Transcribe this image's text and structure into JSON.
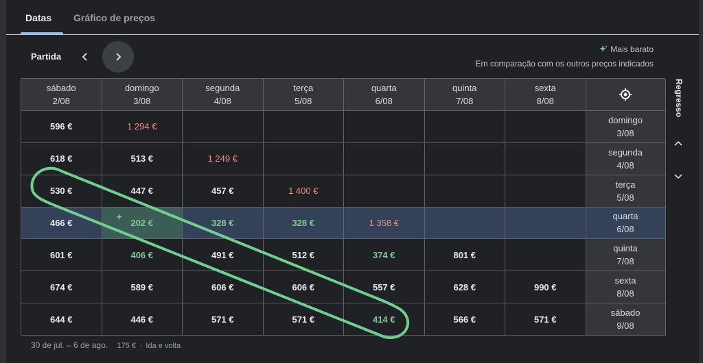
{
  "tabs": [
    {
      "label": "Datas",
      "active": true
    },
    {
      "label": "Gráfico de preços",
      "active": false
    }
  ],
  "toolbar": {
    "departure_label": "Partida",
    "cheapest_label": "Mais barato",
    "comparison_note": "Em comparação com os outros preços indicados"
  },
  "grid": {
    "columns": [
      {
        "day": "sábado",
        "date": "2/08"
      },
      {
        "day": "domingo",
        "date": "3/08"
      },
      {
        "day": "segunda",
        "date": "4/08"
      },
      {
        "day": "terça",
        "date": "5/08"
      },
      {
        "day": "quarta",
        "date": "6/08"
      },
      {
        "day": "quinta",
        "date": "7/08"
      },
      {
        "day": "sexta",
        "date": "8/08"
      }
    ],
    "rows": [
      {
        "day": "domingo",
        "date": "3/08",
        "cells": [
          {
            "v": "596 €"
          },
          {
            "v": "1 294 €",
            "s": "expensive"
          },
          {
            "v": ""
          },
          {
            "v": ""
          },
          {
            "v": ""
          },
          {
            "v": ""
          },
          {
            "v": ""
          }
        ]
      },
      {
        "day": "segunda",
        "date": "4/08",
        "cells": [
          {
            "v": "618 €"
          },
          {
            "v": "513 €"
          },
          {
            "v": "1 249 €",
            "s": "expensive"
          },
          {
            "v": ""
          },
          {
            "v": ""
          },
          {
            "v": ""
          },
          {
            "v": ""
          }
        ]
      },
      {
        "day": "terça",
        "date": "5/08",
        "cells": [
          {
            "v": "530 €"
          },
          {
            "v": "447 €"
          },
          {
            "v": "457 €"
          },
          {
            "v": "1 400 €",
            "s": "expensive"
          },
          {
            "v": ""
          },
          {
            "v": ""
          },
          {
            "v": ""
          }
        ]
      },
      {
        "day": "quarta",
        "date": "6/08",
        "selected": true,
        "cells": [
          {
            "v": "466 €"
          },
          {
            "v": "202 €",
            "s": "cheap",
            "selected": true,
            "star": true
          },
          {
            "v": "328 €",
            "s": "cheap"
          },
          {
            "v": "328 €",
            "s": "cheap"
          },
          {
            "v": "1 358 €",
            "s": "expensive"
          },
          {
            "v": ""
          },
          {
            "v": ""
          }
        ]
      },
      {
        "day": "quinta",
        "date": "7/08",
        "cells": [
          {
            "v": "601 €"
          },
          {
            "v": "406 €",
            "s": "cheap"
          },
          {
            "v": "491 €"
          },
          {
            "v": "512 €"
          },
          {
            "v": "374 €",
            "s": "cheap"
          },
          {
            "v": "801 €"
          },
          {
            "v": ""
          }
        ]
      },
      {
        "day": "sexta",
        "date": "8/08",
        "cells": [
          {
            "v": "674 €"
          },
          {
            "v": "589 €"
          },
          {
            "v": "606 €"
          },
          {
            "v": "606 €"
          },
          {
            "v": "557 €"
          },
          {
            "v": "628 €"
          },
          {
            "v": "990 €"
          }
        ]
      },
      {
        "day": "sábado",
        "date": "9/08",
        "cells": [
          {
            "v": "644 €"
          },
          {
            "v": "446 €"
          },
          {
            "v": "571 €"
          },
          {
            "v": "571 €"
          },
          {
            "v": "414 €",
            "s": "cheap"
          },
          {
            "v": "566 €"
          },
          {
            "v": "571 €"
          }
        ]
      }
    ]
  },
  "side": {
    "return_label": "Regresso"
  },
  "footer": {
    "dates": "30 de jul. – 6 de ago.",
    "price": "175 €",
    "trip_type": "Ida e volta"
  },
  "colors": {
    "accent": "#8ab4f8",
    "cheap": "#81c995",
    "expensive": "#f28b82",
    "selected_row": "#334159",
    "annotation": "#6fcf8e"
  },
  "icons": {
    "prev": "chevron-left-icon",
    "next": "chevron-right-icon",
    "target": "target-icon",
    "sparkle": "sparkle-icon",
    "up": "chevron-up-icon",
    "down": "chevron-down-icon"
  }
}
